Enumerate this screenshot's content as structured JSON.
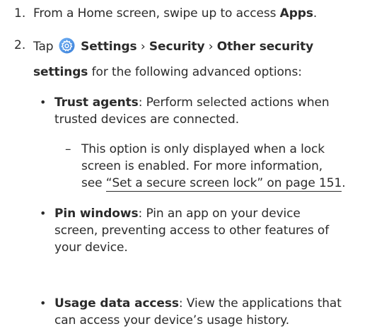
{
  "steps": [
    {
      "number": "1.",
      "before": "From a Home screen, swipe up to access ",
      "bold": "Apps",
      "after": "."
    },
    {
      "number": "2.",
      "tap": "Tap",
      "settings": "Settings",
      "sep1": "›",
      "security": "Security",
      "sep2": "›",
      "other1": "Other security",
      "other2": "settings",
      "rest": " for the following advanced options:"
    }
  ],
  "options": [
    {
      "name": "Trust agents",
      "line1": ": Perform selected actions when",
      "line2": "trusted devices are connected.",
      "note": {
        "line1": "This option is only displayed when a lock",
        "line2": "screen is enabled. For more information,",
        "line3_prefix": "see ",
        "link": "“Set a secure screen lock” on page 151",
        "line3_suffix": "."
      }
    },
    {
      "name": "Pin windows",
      "line1": ": Pin an app on your device",
      "line2": "screen, preventing access to other features of",
      "line3": "your device."
    },
    {
      "name": "Usage data access",
      "line1": ": View the applications that",
      "line2": "can access your device’s usage history."
    }
  ],
  "icons": {
    "settings": "settings-gear-icon",
    "settings_color": "#4a8fe0"
  },
  "bullet_char": "•",
  "dash_char": "–"
}
